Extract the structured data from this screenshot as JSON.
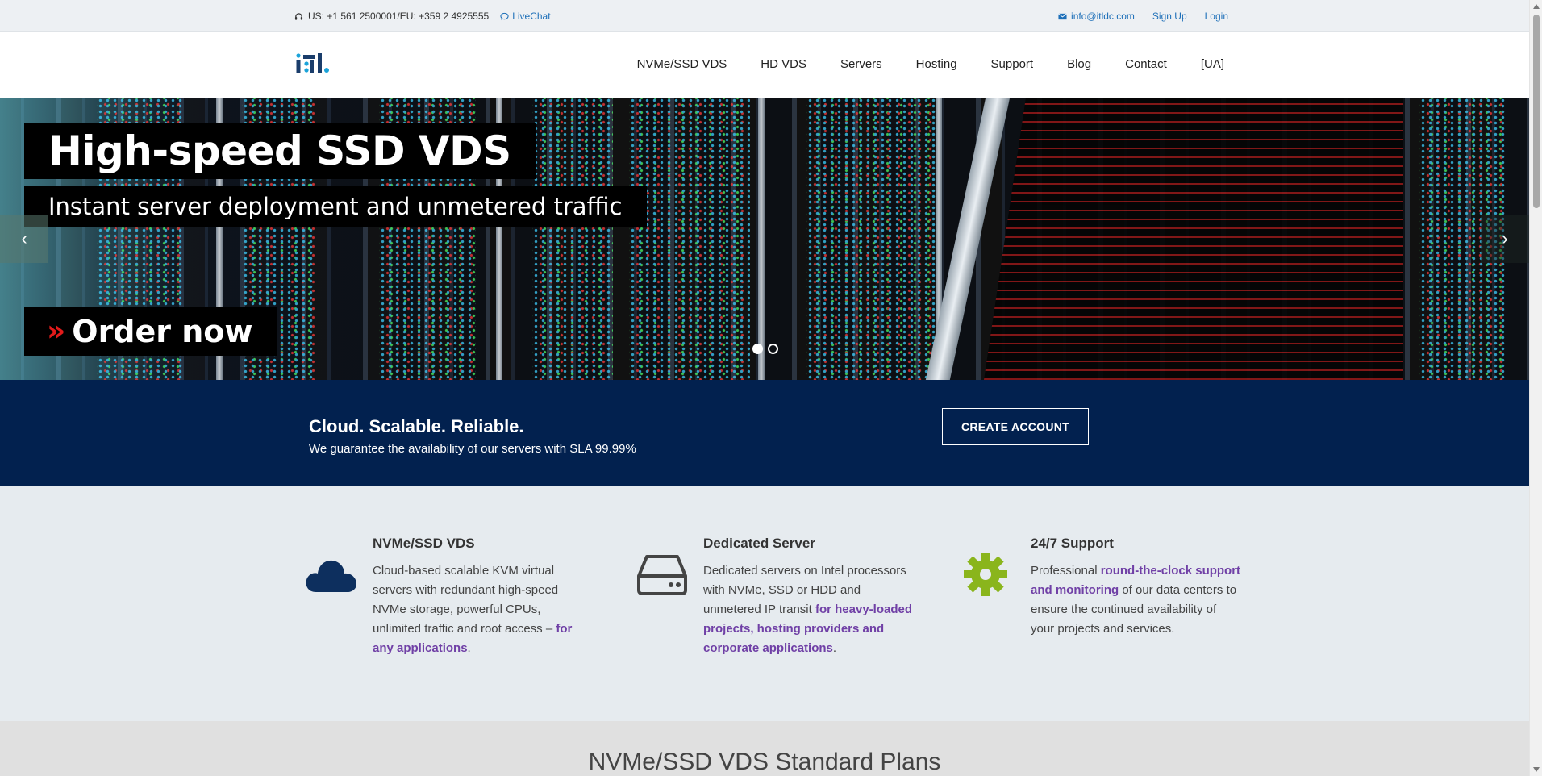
{
  "topbar": {
    "phones": "US: +1 561 2500001/EU: +359 2 4925555",
    "livechat": "LiveChat",
    "email": "info@itldc.com",
    "signup": "Sign Up",
    "login": "Login"
  },
  "nav": {
    "items": [
      "NVMe/SSD VDS",
      "HD VDS",
      "Servers",
      "Hosting",
      "Support",
      "Blog",
      "Contact",
      "[UA]"
    ]
  },
  "hero": {
    "title": "High-speed SSD VDS",
    "subtitle": "Instant server deployment and unmetered traffic",
    "cta": "Order now",
    "arrows": "»",
    "prev": "‹",
    "next": "›"
  },
  "band": {
    "title": "Cloud. Scalable. Reliable.",
    "subtitle": "We guarantee the availability of our servers with SLA 99.99%",
    "button": "CREATE ACCOUNT"
  },
  "features": [
    {
      "title": "NVMe/SSD VDS",
      "text": "Cloud-based scalable KVM virtual servers with redundant high-speed NVMe storage, powerful CPUs, unlimited traffic and root access – ",
      "highlight": "for any applications",
      "end": ".",
      "icon": "cloud-icon",
      "color": "#0d2f5e"
    },
    {
      "title": "Dedicated Server",
      "text": "Dedicated servers on Intel processors with NVMe, SSD or HDD and unmetered IP transit ",
      "highlight": "for heavy-loaded projects, hosting providers and corporate applications",
      "end": ".",
      "icon": "hdd-icon",
      "color": "#444444"
    },
    {
      "title": "24/7 Support",
      "text": "Professional ",
      "highlight": "round-the-clock support and monitoring",
      "end": " of our data centers to ensure the continued availability of your projects and services.",
      "icon": "gear-icon",
      "color": "#8ab51c"
    }
  ],
  "plans": {
    "title": "NVMe/SSD VDS Standard Plans"
  },
  "colors": {
    "band": "#02214f",
    "link": "#1d6fb8",
    "highlight": "#7040a6",
    "order_arrows": "#e21b1b"
  }
}
